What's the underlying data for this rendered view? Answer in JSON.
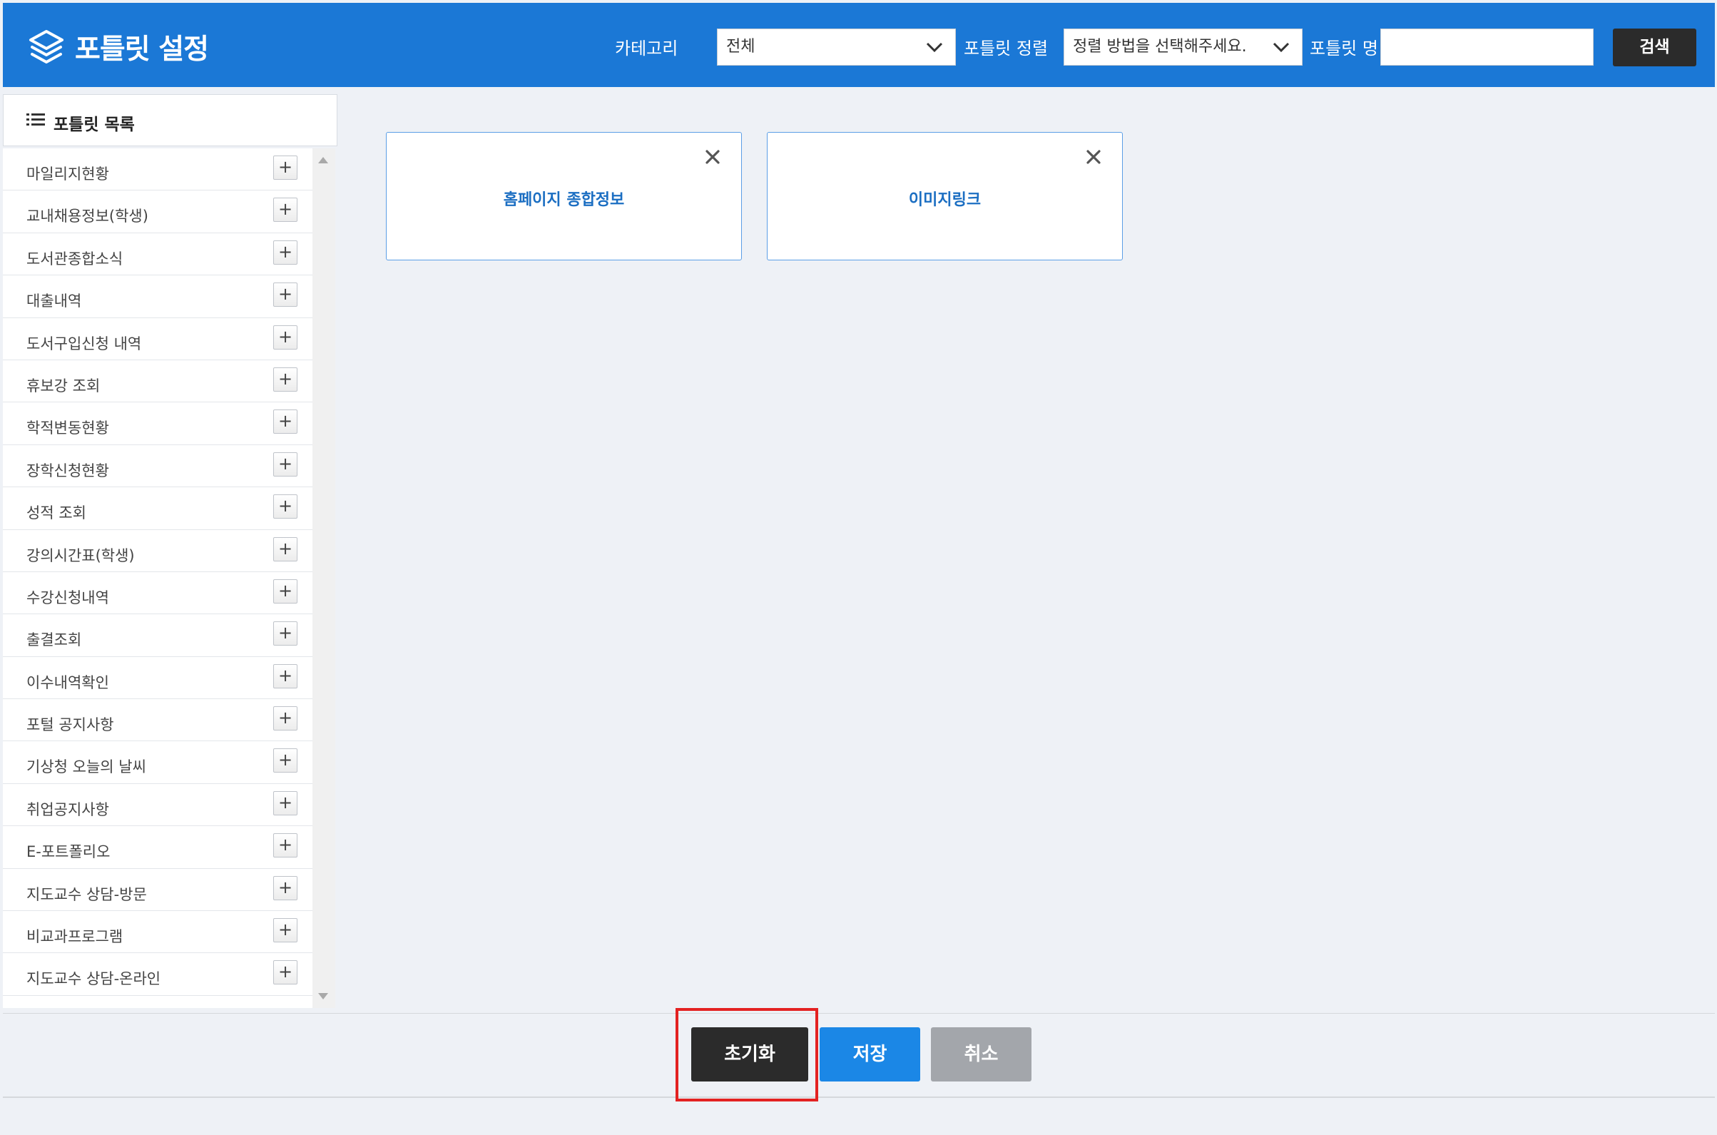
{
  "header": {
    "title": "포틀릿 설정",
    "category_label": "카테고리",
    "category_value": "전체",
    "sort_label": "포틀릿 정렬",
    "sort_value": "정렬 방법을 선택해주세요.",
    "name_label": "포틀릿 명",
    "name_value": "",
    "search_button": "검색"
  },
  "sidebar": {
    "title": "포틀릿 목록",
    "items": [
      "마일리지현황",
      "교내채용정보(학생)",
      "도서관종합소식",
      "대출내역",
      "도서구입신청 내역",
      "휴보강 조회",
      "학적변동현황",
      "장학신청현황",
      "성적 조회",
      "강의시간표(학생)",
      "수강신청내역",
      "출결조회",
      "이수내역확인",
      "포털 공지사항",
      "기상청 오늘의 날씨",
      "취업공지사항",
      "E-포트폴리오",
      "지도교수 상담-방문",
      "비교과프로그램",
      "지도교수 상담-온라인"
    ],
    "add_symbol": "+"
  },
  "selected_portlets": [
    {
      "title": "홈페이지 종합정보"
    },
    {
      "title": "이미지링크"
    }
  ],
  "footer": {
    "reset_button": "초기화",
    "save_button": "저장",
    "cancel_button": "취소"
  },
  "colors": {
    "header_bg": "#1b78d6",
    "card_border": "#5b9ee6",
    "card_title": "#1b6ec2",
    "reset_bg": "#2b2b2b",
    "save_bg": "#1b87e6",
    "cancel_bg": "#a3a6ab",
    "highlight": "#e32222"
  }
}
